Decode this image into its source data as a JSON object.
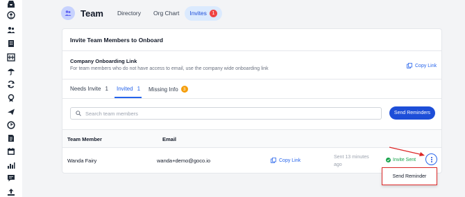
{
  "header": {
    "title": "Team",
    "nav": [
      {
        "label": "Directory"
      },
      {
        "label": "Org Chart"
      },
      {
        "label": "Invites",
        "badge": "1"
      }
    ]
  },
  "card": {
    "title": "Invite Team Members to Onboard",
    "onboarding": {
      "title": "Company Onboarding Link",
      "subtitle": "For team members who do not have access to email, use the company wide onboarding link",
      "copy_link": "Copy Link"
    },
    "tabs": [
      {
        "label": "Needs Invite",
        "count": "1"
      },
      {
        "label": "Invited",
        "count": "1"
      },
      {
        "label": "Missing Info",
        "count": "3"
      }
    ],
    "search": {
      "placeholder": "Search team members"
    },
    "send_reminders": "Send Reminders",
    "table": {
      "columns": [
        "Team Member",
        "Email"
      ],
      "rows": [
        {
          "name": "Wanda Fairy",
          "email": "wanda+demo@goco.io",
          "copy_link": "Copy Link",
          "sent": "Sent 13 minutes ago",
          "status": "Invite Sent"
        }
      ]
    },
    "menu": {
      "items": [
        "Send Reminder"
      ]
    }
  },
  "colors": {
    "accent": "#1d4ed8",
    "link": "#2563eb",
    "success": "#16a34a",
    "badge_red": "#ef4444",
    "badge_orange": "#f59e0b",
    "annotation": "#dc2626"
  },
  "sidebar": {
    "icons": [
      "inbox-icon",
      "user-circle-icon",
      "people-icon",
      "building-icon",
      "budget-icon",
      "umbrella-icon",
      "refresh-icon",
      "award-icon",
      "plane-icon",
      "clock-icon",
      "document-icon",
      "calendar-icon",
      "chart-icon",
      "chat-icon",
      "upload-icon"
    ]
  }
}
